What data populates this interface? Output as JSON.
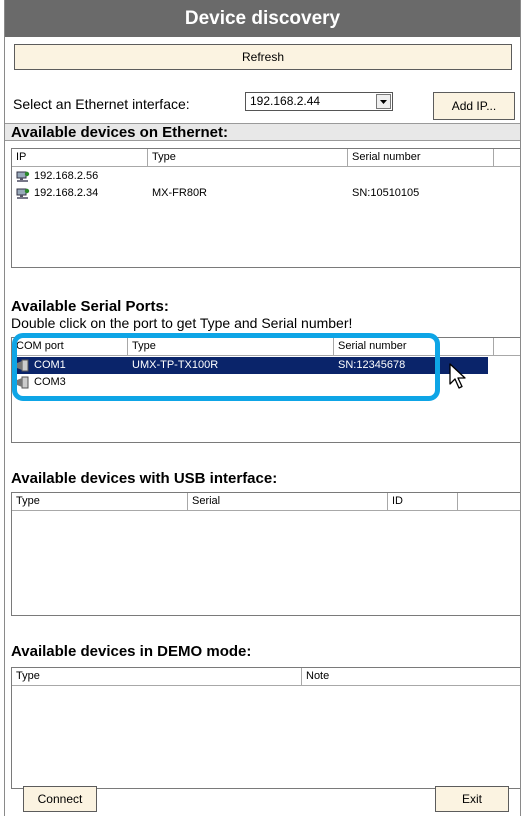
{
  "window": {
    "title": "Device discovery"
  },
  "toolbar": {
    "refresh_label": "Refresh"
  },
  "ethernet": {
    "select_label": "Select an Ethernet interface:",
    "interface_value": "192.168.2.44",
    "add_ip_label": "Add IP...",
    "section_title": "Available devices on Ethernet:",
    "columns": [
      "IP",
      "Type",
      "Serial number"
    ],
    "rows": [
      {
        "ip": "192.168.2.56",
        "type": "",
        "serial": ""
      },
      {
        "ip": "192.168.2.34",
        "type": "MX-FR80R",
        "serial": "SN:10510105"
      }
    ]
  },
  "serial": {
    "section_title": "Available Serial Ports:",
    "hint": "Double click on the port to get Type and Serial number!",
    "columns": [
      "COM port",
      "Type",
      "Serial number"
    ],
    "rows": [
      {
        "port": "COM1",
        "type": "UMX-TP-TX100R",
        "serial": "SN:12345678",
        "selected": true
      },
      {
        "port": "COM3",
        "type": "",
        "serial": "",
        "selected": false
      }
    ]
  },
  "usb": {
    "section_title": "Available devices with USB interface:",
    "columns": [
      "Type",
      "Serial",
      "ID"
    ]
  },
  "demo": {
    "section_title": "Available devices in DEMO mode:",
    "columns": [
      "Type",
      "Note"
    ]
  },
  "footer": {
    "connect_label": "Connect",
    "exit_label": "Exit"
  },
  "colors": {
    "title_bg": "#6a6a6a",
    "button_bg": "#fbf3e1",
    "selection_bg": "#0a246a",
    "highlight": "#0ea5e6"
  },
  "icons": {
    "ethernet_device": "network-device-icon",
    "serial_port": "serial-port-icon"
  }
}
